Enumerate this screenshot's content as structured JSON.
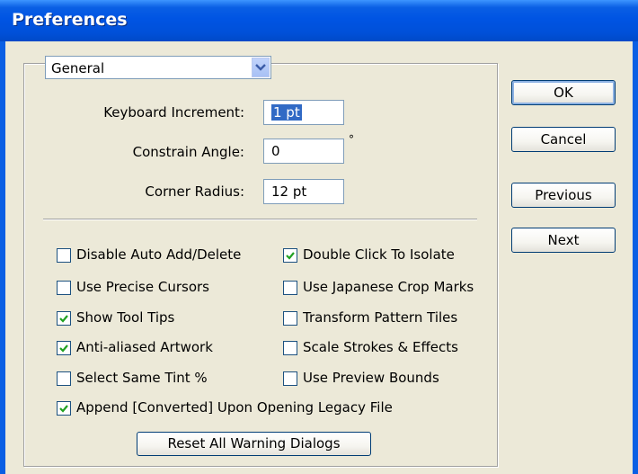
{
  "window": {
    "title": "Preferences"
  },
  "category_select": {
    "value": "General"
  },
  "fields": {
    "keyboard_increment": {
      "label": "Keyboard Increment:",
      "value": "1 pt"
    },
    "constrain_angle": {
      "label": "Constrain Angle:",
      "value": "0",
      "unit": "°"
    },
    "corner_radius": {
      "label": "Corner Radius:",
      "value": "12 pt"
    }
  },
  "checkboxes": [
    {
      "label": "Disable Auto Add/Delete",
      "checked": false
    },
    {
      "label": "Double Click To Isolate",
      "checked": true
    },
    {
      "label": "Use Precise Cursors",
      "checked": false
    },
    {
      "label": "Use Japanese Crop Marks",
      "checked": false
    },
    {
      "label": "Show Tool Tips",
      "checked": true
    },
    {
      "label": "Transform Pattern Tiles",
      "checked": false
    },
    {
      "label": "Anti-aliased Artwork",
      "checked": true
    },
    {
      "label": "Scale Strokes & Effects",
      "checked": false
    },
    {
      "label": "Select Same Tint %",
      "checked": false
    },
    {
      "label": "Use Preview Bounds",
      "checked": false
    },
    {
      "label": "Append [Converted] Upon Opening Legacy File",
      "checked": true
    }
  ],
  "buttons": {
    "ok": "OK",
    "cancel": "Cancel",
    "previous": "Previous",
    "next": "Next",
    "reset_warnings": "Reset All Warning Dialogs"
  },
  "colors": {
    "title_bar": "#0054e3",
    "dialog_bg": "#ece9d8",
    "selection": "#316ac5"
  }
}
